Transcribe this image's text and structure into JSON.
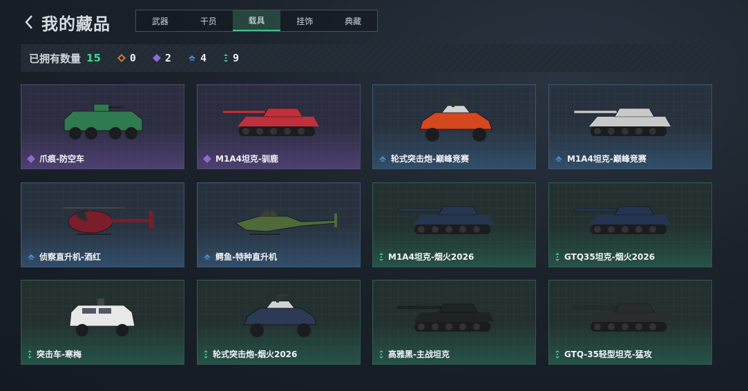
{
  "header": {
    "title": "我的藏品"
  },
  "tabs": [
    {
      "label": "武器"
    },
    {
      "label": "干员"
    },
    {
      "label": "载具"
    },
    {
      "label": "挂饰"
    },
    {
      "label": "典藏"
    }
  ],
  "stats": {
    "owned_label": "已拥有数量",
    "owned_count": "15",
    "tiers": [
      {
        "icon": "orange-diamond-icon",
        "color": "#c07a3a",
        "value": "0"
      },
      {
        "icon": "purple-diamond-icon",
        "color": "#8e6ad6",
        "value": "2"
      },
      {
        "icon": "blue-chevron-icon",
        "color": "#4c93d4",
        "value": "4"
      },
      {
        "icon": "green-dots-icon",
        "color": "#3fc28f",
        "value": "9"
      }
    ]
  },
  "items": [
    {
      "name": "爪痕-防空车",
      "tier": "purple",
      "vehicle": "wheeled-apc"
    },
    {
      "name": "M1A4坦克-驯鹿",
      "tier": "purple",
      "vehicle": "tank"
    },
    {
      "name": "轮式突击炮-巅峰竞赛",
      "tier": "blue",
      "vehicle": "buggy"
    },
    {
      "name": "M1A4坦克-巅峰竞赛",
      "tier": "blue",
      "vehicle": "tank"
    },
    {
      "name": "侦察直升机-酒红",
      "tier": "blue",
      "vehicle": "small-helicopter"
    },
    {
      "name": "鳄鱼-特种直升机",
      "tier": "blue",
      "vehicle": "attack-helicopter"
    },
    {
      "name": "M1A4坦克-烟火2026",
      "tier": "green",
      "vehicle": "tank"
    },
    {
      "name": "GTQ35坦克-烟火2026",
      "tier": "green",
      "vehicle": "tank"
    },
    {
      "name": "突击车-寒梅",
      "tier": "green",
      "vehicle": "armored-car"
    },
    {
      "name": "轮式突击炮-烟火2026",
      "tier": "green",
      "vehicle": "buggy"
    },
    {
      "name": "高雅黑-主战坦克",
      "tier": "green",
      "vehicle": "tank"
    },
    {
      "name": "GTQ-35轻型坦克-猛攻",
      "tier": "green",
      "vehicle": "tank"
    }
  ],
  "tier_colors": {
    "purple": "#8e6ad6",
    "blue": "#4c93d4",
    "green": "#3fc28f"
  },
  "vehicle_colors": [
    "#2f7a4f",
    "#c0303a",
    "#d4471f",
    "#c9c9c9",
    "#7a1e2c",
    "#4f6a3a",
    "#27364f",
    "#243452",
    "#e8e8e8",
    "#2d3a55",
    "#1f2326",
    "#2a2d30"
  ]
}
